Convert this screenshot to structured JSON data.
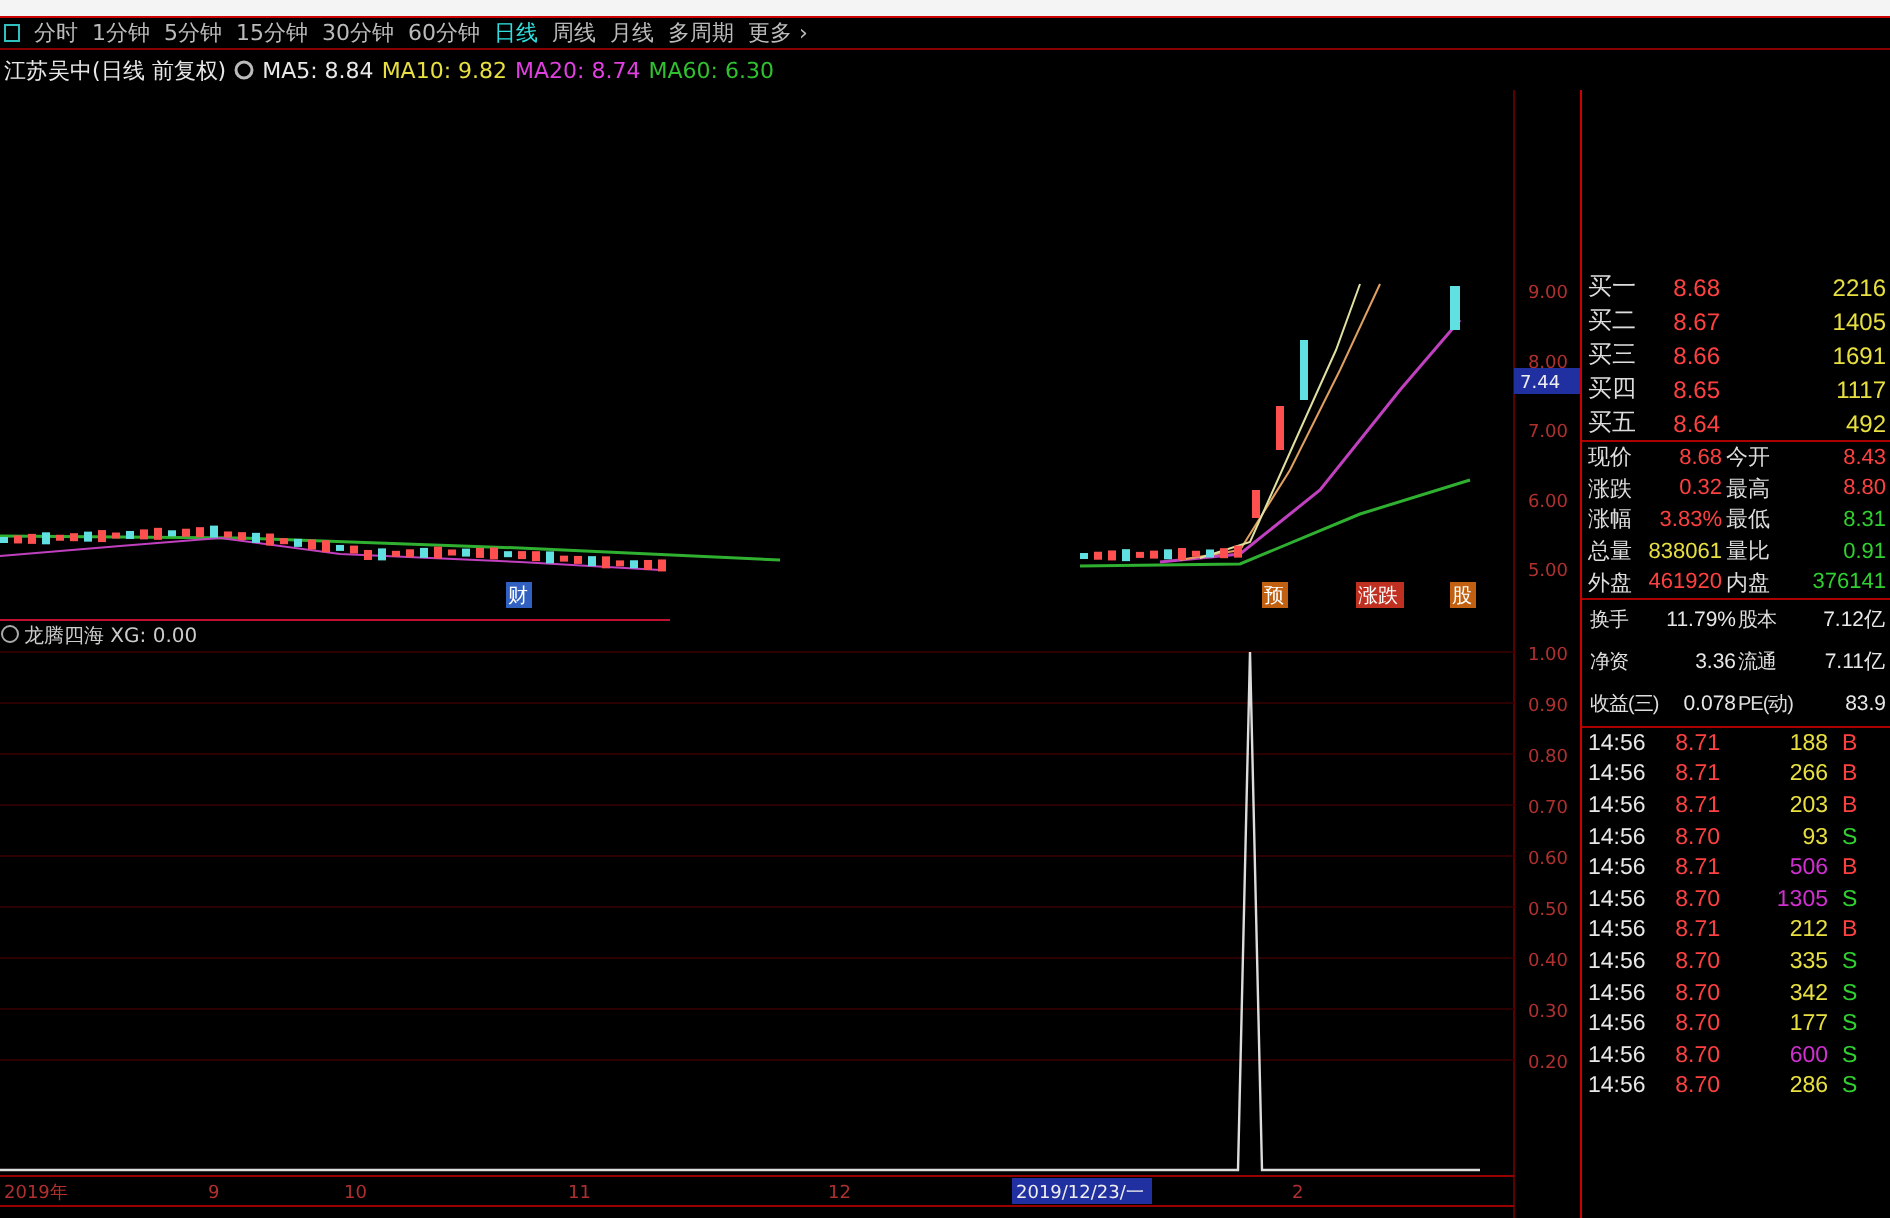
{
  "period_tabs": [
    {
      "label": "分时",
      "selected": false
    },
    {
      "label": "1分钟",
      "selected": false
    },
    {
      "label": "5分钟",
      "selected": false
    },
    {
      "label": "15分钟",
      "selected": false
    },
    {
      "label": "30分钟",
      "selected": false
    },
    {
      "label": "60分钟",
      "selected": false
    },
    {
      "label": "日线",
      "selected": true
    },
    {
      "label": "周线",
      "selected": false
    },
    {
      "label": "月线",
      "selected": false
    },
    {
      "label": "多周期",
      "selected": false
    },
    {
      "label": "更多 ›",
      "selected": false
    }
  ],
  "chart_title": {
    "stock": "江苏吴中(日线 前复权)",
    "moving_averages": [
      {
        "label": "MA5: 8.84",
        "color": "#e8e8e8"
      },
      {
        "label": "MA10: 9.82",
        "color": "#e8e040"
      },
      {
        "label": "MA20: 8.74",
        "color": "#e040e0"
      },
      {
        "label": "MA60: 6.30",
        "color": "#30c030"
      }
    ]
  },
  "price_axis": [
    "9.00",
    "8.00",
    "7.00",
    "6.00",
    "5.00"
  ],
  "price_cursor": "7.44",
  "event_markers": [
    {
      "label": "财",
      "color": "#3060c0"
    },
    {
      "label": "预",
      "color": "#c06010"
    },
    {
      "label": "涨跌",
      "color": "#c03020"
    },
    {
      "label": "股",
      "color": "#c06010"
    }
  ],
  "indicator": {
    "title": "龙腾四海 XG: 0.00",
    "axis": [
      "1.00",
      "0.90",
      "0.80",
      "0.70",
      "0.60",
      "0.50",
      "0.40",
      "0.30",
      "0.20"
    ]
  },
  "date_axis": [
    {
      "label": "2019年",
      "selected": false
    },
    {
      "label": "9",
      "selected": false
    },
    {
      "label": "10",
      "selected": false
    },
    {
      "label": "11",
      "selected": false
    },
    {
      "label": "12",
      "selected": false
    },
    {
      "label": "2019/12/23/一",
      "selected": true
    },
    {
      "label": "2",
      "selected": false
    }
  ],
  "order_book": [
    {
      "label": "买一",
      "price": "8.68",
      "volume": "2216"
    },
    {
      "label": "买二",
      "price": "8.67",
      "volume": "1405"
    },
    {
      "label": "买三",
      "price": "8.66",
      "volume": "1691"
    },
    {
      "label": "买四",
      "price": "8.65",
      "volume": "1117"
    },
    {
      "label": "买五",
      "price": "8.64",
      "volume": "492"
    }
  ],
  "quote": [
    [
      {
        "label": "现价",
        "value": "8.68",
        "color": "#ff4040"
      },
      {
        "label": "今开",
        "value": "8.43",
        "color": "#ff4040"
      }
    ],
    [
      {
        "label": "涨跌",
        "value": "0.32",
        "color": "#ff4040"
      },
      {
        "label": "最高",
        "value": "8.80",
        "color": "#ff4040"
      }
    ],
    [
      {
        "label": "涨幅",
        "value": "3.83%",
        "color": "#ff4040"
      },
      {
        "label": "最低",
        "value": "8.31",
        "color": "#30d030"
      }
    ],
    [
      {
        "label": "总量",
        "value": "838061",
        "color": "#e8e040"
      },
      {
        "label": "量比",
        "value": "0.91",
        "color": "#30d030"
      }
    ],
    [
      {
        "label": "外盘",
        "value": "461920",
        "color": "#ff4040"
      },
      {
        "label": "内盘",
        "value": "376141",
        "color": "#30d030"
      }
    ]
  ],
  "fundamentals": [
    [
      {
        "label": "换手",
        "value": "11.79%"
      },
      {
        "label": "股本",
        "value": "7.12亿"
      }
    ],
    [
      {
        "label": "净资",
        "value": "3.36"
      },
      {
        "label": "流通",
        "value": "7.11亿"
      }
    ],
    [
      {
        "label": "收益(三)",
        "value": "0.078"
      },
      {
        "label": "PE(动)",
        "value": "83.9"
      }
    ]
  ],
  "trades": [
    {
      "time": "14:56",
      "price": "8.71",
      "volume": "188",
      "color": "#e8e040",
      "side": "B",
      "kind": "buy"
    },
    {
      "time": "14:56",
      "price": "8.71",
      "volume": "266",
      "color": "#e8e040",
      "side": "B",
      "kind": "buy"
    },
    {
      "time": "14:56",
      "price": "8.71",
      "volume": "203",
      "color": "#e8e040",
      "side": "B",
      "kind": "buy"
    },
    {
      "time": "14:56",
      "price": "8.70",
      "volume": "93",
      "color": "#e8e040",
      "side": "S",
      "kind": "sell"
    },
    {
      "time": "14:56",
      "price": "8.71",
      "volume": "506",
      "color": "#d030d0",
      "side": "B",
      "kind": "buy"
    },
    {
      "time": "14:56",
      "price": "8.70",
      "volume": "1305",
      "color": "#d030d0",
      "side": "S",
      "kind": "sell"
    },
    {
      "time": "14:56",
      "price": "8.71",
      "volume": "212",
      "color": "#e8e040",
      "side": "B",
      "kind": "buy"
    },
    {
      "time": "14:56",
      "price": "8.70",
      "volume": "335",
      "color": "#e8e040",
      "side": "S",
      "kind": "sell"
    },
    {
      "time": "14:56",
      "price": "8.70",
      "volume": "342",
      "color": "#e8e040",
      "side": "S",
      "kind": "sell"
    },
    {
      "time": "14:56",
      "price": "8.70",
      "volume": "177",
      "color": "#e8e040",
      "side": "S",
      "kind": "sell"
    },
    {
      "time": "14:56",
      "price": "8.70",
      "volume": "600",
      "color": "#d030d0",
      "side": "S",
      "kind": "sell"
    },
    {
      "time": "14:56",
      "price": "8.70",
      "volume": "286",
      "color": "#e8e040",
      "side": "S",
      "kind": "sell"
    }
  ]
}
